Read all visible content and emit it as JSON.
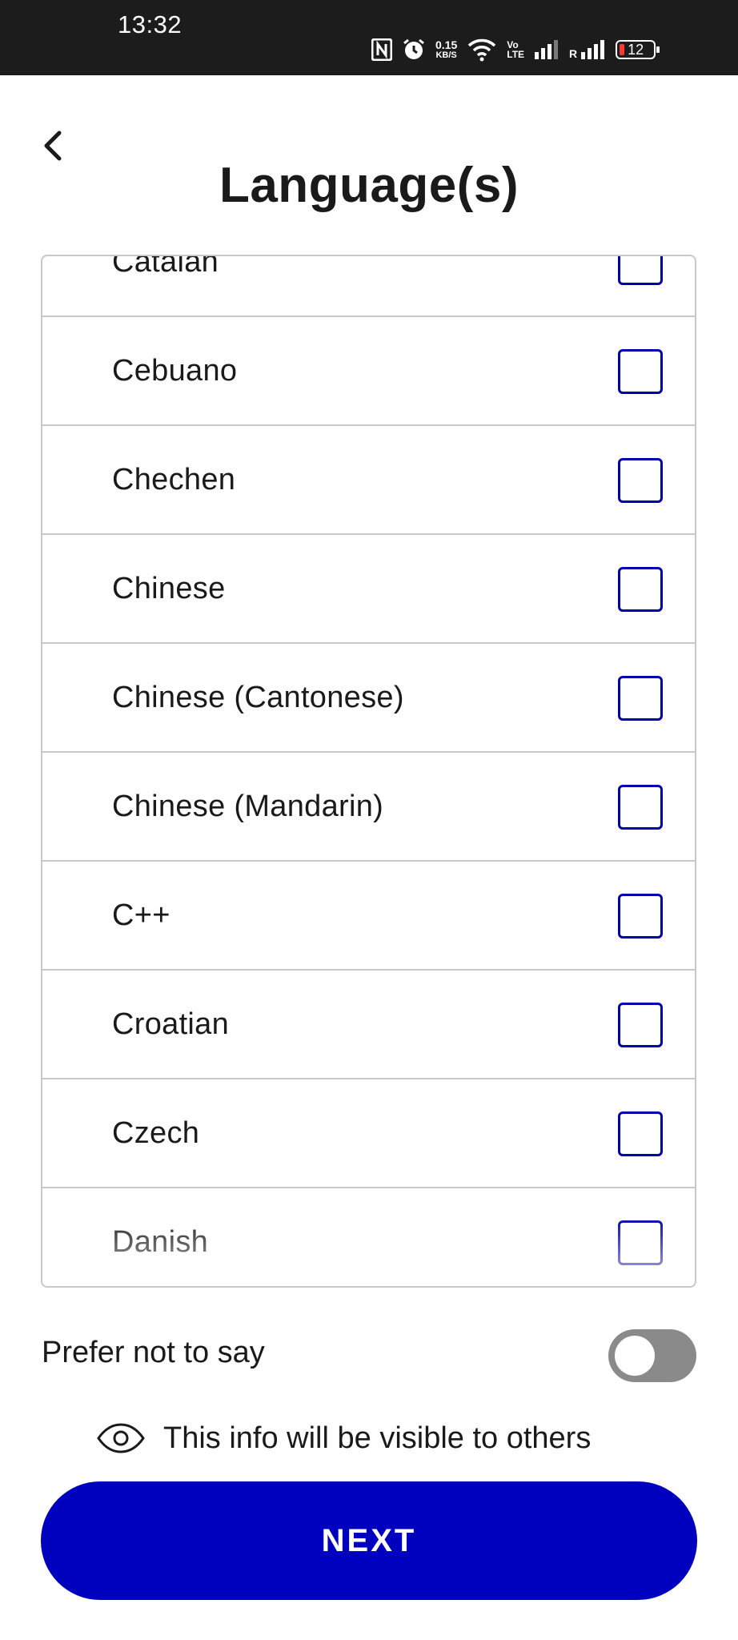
{
  "status_bar": {
    "time": "13:32",
    "speed_value": "0.15",
    "speed_unit": "KB/S",
    "volte_top": "Vo",
    "volte_bottom": "LTE",
    "roaming": "R",
    "battery": "12",
    "icons": [
      "nfc-icon",
      "alarm-icon",
      "wifi-icon",
      "signal-icon",
      "signal-roaming-icon",
      "battery-icon"
    ]
  },
  "header": {
    "title": "Language(s)",
    "back_icon": "chevron-left-icon"
  },
  "languages": {
    "items": [
      {
        "label": "Catalan",
        "checked": false
      },
      {
        "label": "Cebuano",
        "checked": false
      },
      {
        "label": "Chechen",
        "checked": false
      },
      {
        "label": "Chinese",
        "checked": false
      },
      {
        "label": "Chinese (Cantonese)",
        "checked": false
      },
      {
        "label": "Chinese (Mandarin)",
        "checked": false
      },
      {
        "label": "C++",
        "checked": false
      },
      {
        "label": "Croatian",
        "checked": false
      },
      {
        "label": "Czech",
        "checked": false
      },
      {
        "label": "Danish",
        "checked": false
      }
    ]
  },
  "prefer": {
    "label": "Prefer not to say",
    "enabled": false
  },
  "visibility_note": {
    "icon": "eye-icon",
    "text": "This info will be visible to others"
  },
  "next_button": {
    "label": "NEXT"
  },
  "colors": {
    "accent": "#0000bf",
    "checkbox_border": "#0000a8",
    "toggle_off": "#8a8a8a",
    "status_bar_bg": "#1c1c1c"
  }
}
